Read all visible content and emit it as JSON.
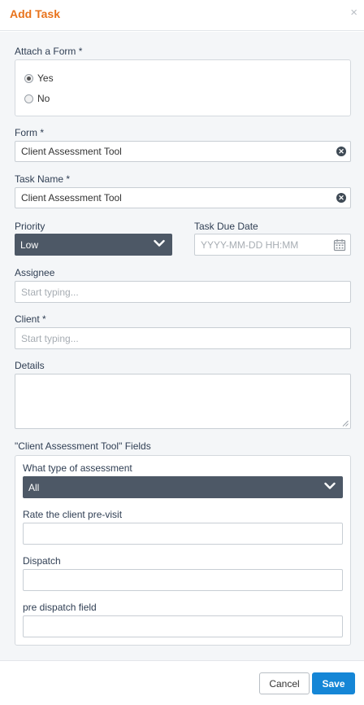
{
  "dialog": {
    "title": "Add Task",
    "close_symbol": "×"
  },
  "attach_form": {
    "label": "Attach a Form *",
    "options": [
      {
        "label": "Yes",
        "checked": true
      },
      {
        "label": "No",
        "checked": false
      }
    ]
  },
  "form": {
    "label": "Form *",
    "value": "Client Assessment Tool"
  },
  "task_name": {
    "label": "Task Name *",
    "value": "Client Assessment Tool"
  },
  "priority": {
    "label": "Priority",
    "value": "Low"
  },
  "due_date": {
    "label": "Task Due Date",
    "placeholder": "YYYY-MM-DD HH:MM"
  },
  "assignee": {
    "label": "Assignee",
    "placeholder": "Start typing..."
  },
  "client": {
    "label": "Client *",
    "placeholder": "Start typing..."
  },
  "details": {
    "label": "Details",
    "value": ""
  },
  "form_fields": {
    "section_label": "\"Client Assessment Tool\" Fields",
    "assessment_type": {
      "label": "What type of assessment",
      "value": "All"
    },
    "rate_pre_visit": {
      "label": "Rate the client pre-visit",
      "value": ""
    },
    "dispatch": {
      "label": "Dispatch",
      "value": ""
    },
    "pre_dispatch": {
      "label": "pre dispatch field",
      "value": ""
    }
  },
  "footer": {
    "cancel_label": "Cancel",
    "save_label": "Save"
  },
  "icons": {
    "close": "close-icon",
    "clear": "clear-icon",
    "chevron": "chevron-down-icon",
    "calendar": "calendar-icon"
  },
  "colors": {
    "title": "#e8731c",
    "label": "#2f3e53",
    "select_bg": "#4d5866",
    "primary": "#1586d6",
    "background": "#f4f6f8"
  }
}
